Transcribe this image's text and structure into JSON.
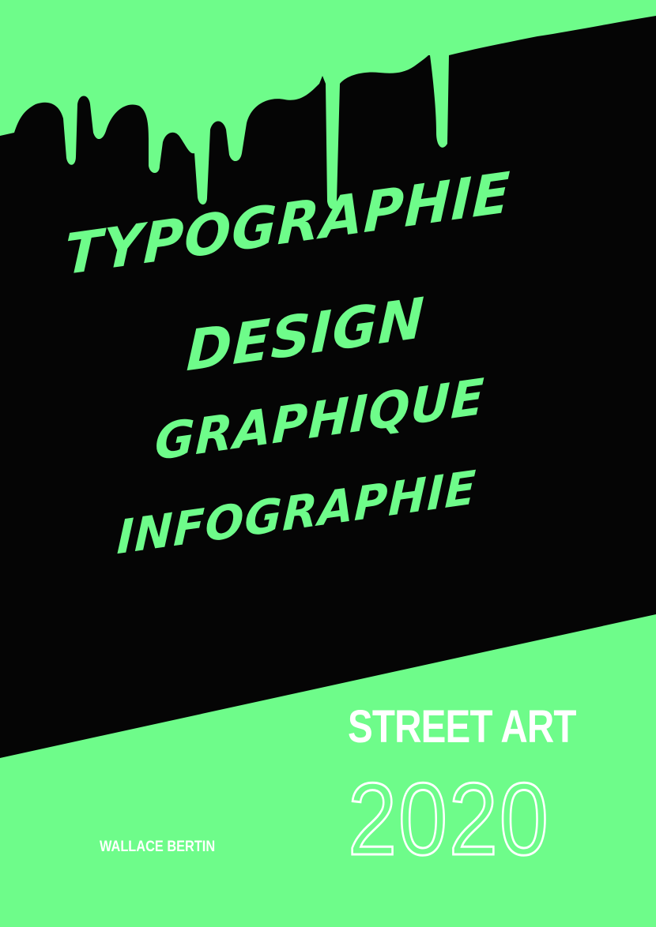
{
  "colors": {
    "accent_green": "#6efc8a",
    "background_black": "#050505",
    "text_white": "#ffffff"
  },
  "headline_lines": [
    "Typographie",
    "design",
    "graphique",
    "infographie"
  ],
  "title": "STREET ART",
  "year": "2020",
  "author": "WALLACE BERTIN"
}
